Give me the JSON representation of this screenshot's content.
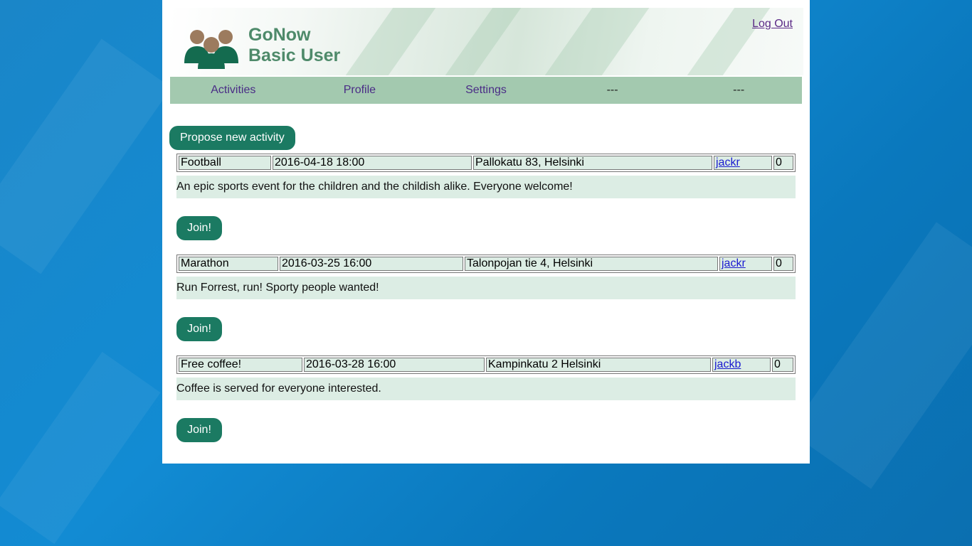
{
  "app": {
    "name": "GoNow",
    "role": "Basic User",
    "logout_label": "Log Out"
  },
  "nav": {
    "items": [
      {
        "label": "Activities"
      },
      {
        "label": "Profile"
      },
      {
        "label": "Settings"
      },
      {
        "label": "---"
      },
      {
        "label": "---"
      }
    ]
  },
  "actions": {
    "propose_label": "Propose new activity"
  },
  "activities": [
    {
      "name": "Football",
      "datetime": "2016-04-18 18:00",
      "location": "Pallokatu 83, Helsinki",
      "organizer": "jackr",
      "participants": "0",
      "description": "An epic sports event for the children and the childish alike. Everyone welcome!",
      "join_label": "Join!"
    },
    {
      "name": "Marathon",
      "datetime": "2016-03-25 16:00",
      "location": "Talonpojan tie 4, Helsinki",
      "organizer": "jackr",
      "participants": "0",
      "description": "Run Forrest, run! Sporty people wanted!",
      "join_label": "Join!"
    },
    {
      "name": "Free coffee!",
      "datetime": "2016-03-28 16:00",
      "location": "Kampinkatu 2 Helsinki",
      "organizer": "jackb",
      "participants": "0",
      "description": "Coffee is served for everyone interested.",
      "join_label": "Join!"
    }
  ],
  "colors": {
    "accent": "#1b7a62",
    "nav_bg": "#a3c9af",
    "row_bg": "#dcede4",
    "title": "#4e8a6a",
    "page_bg": "#128bd3"
  }
}
